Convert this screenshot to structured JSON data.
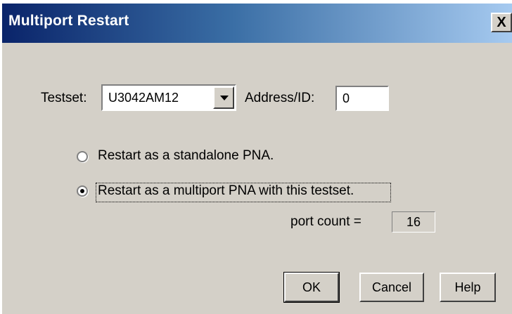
{
  "window": {
    "title": "Multiport Restart",
    "close_glyph": "X"
  },
  "testset": {
    "label": "Testset:",
    "selected": "U3042AM12"
  },
  "address": {
    "label": "Address/ID:",
    "value": "0"
  },
  "options": [
    {
      "label": "Restart as a standalone PNA.",
      "checked": false
    },
    {
      "label": "Restart as a multiport PNA with this testset.",
      "checked": true
    }
  ],
  "port_count": {
    "label": "port count =",
    "value": "16"
  },
  "buttons": {
    "ok": "OK",
    "cancel": "Cancel",
    "help": "Help"
  },
  "colors": {
    "dialog_face": "#d4d0c8",
    "titlebar_start": "#0a246a",
    "titlebar_end": "#a6caf0"
  }
}
